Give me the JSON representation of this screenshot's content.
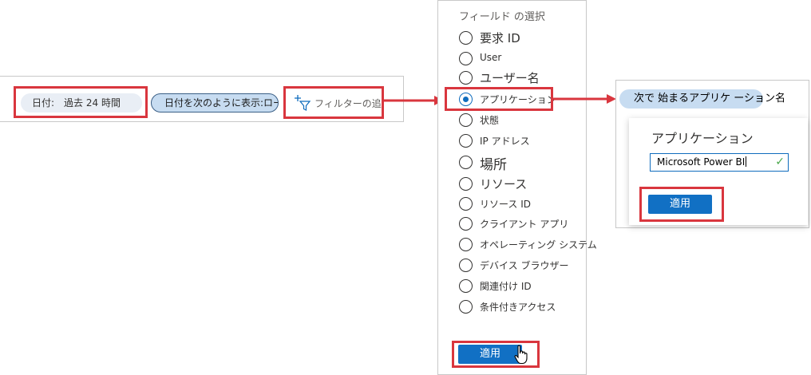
{
  "filter_bar": {
    "date_label": "日付:",
    "date_value": "過去 24 時間",
    "timezone_label": "日付を次のように表示:ローカル",
    "add_filter_label": "フィルターの追加"
  },
  "field_panel": {
    "title": "フィールド の選択",
    "options": [
      {
        "label": "要求 ID",
        "selected": false
      },
      {
        "label": "User",
        "selected": false
      },
      {
        "label": "ユーザー名",
        "selected": false
      },
      {
        "label": "アプリケーション",
        "selected": true
      },
      {
        "label": "状態",
        "selected": false
      },
      {
        "label": "IP アドレス",
        "selected": false
      },
      {
        "label": "場所",
        "selected": false
      },
      {
        "label": "リソース",
        "selected": false
      },
      {
        "label": "リソース ID",
        "selected": false
      },
      {
        "label": "クライアント アプリ",
        "selected": false
      },
      {
        "label": "オペレーティング システム",
        "selected": false
      },
      {
        "label": "デバイス ブラウザー",
        "selected": false
      },
      {
        "label": "関連付け ID",
        "selected": false
      },
      {
        "label": "条件付きアクセス",
        "selected": false
      }
    ],
    "apply_label": "適用"
  },
  "popup": {
    "starts_with_label": "次で 始まるアプリケ ーション名",
    "title": "アプリケーション",
    "input_value": "Microsoft Power BI",
    "apply_label": "適用"
  },
  "colors": {
    "highlight": "#d9363e",
    "primary": "#1170c4",
    "pill_selected": "#c7dcf1",
    "pill_default": "#e9eef5"
  },
  "icons": [
    "add-filter-icon",
    "pointer-cursor-icon",
    "checkmark-icon"
  ]
}
